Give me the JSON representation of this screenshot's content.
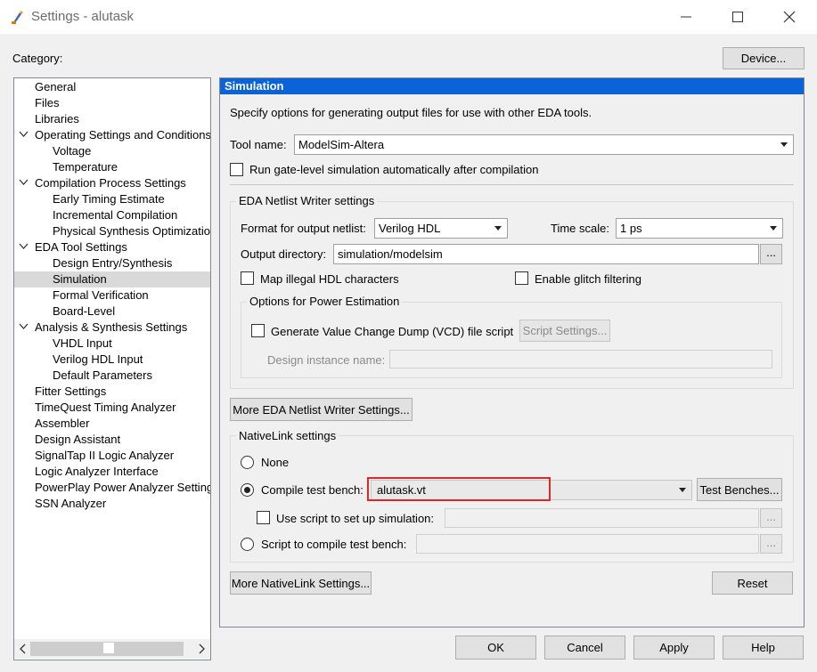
{
  "window": {
    "title": "Settings - alutask",
    "minimize_glyph": "—",
    "maximize_glyph": "☐",
    "close_glyph": "✕"
  },
  "category_label": "Category:",
  "device_button": "Device...",
  "tree": {
    "items": [
      {
        "label": "General",
        "level": 0,
        "expanded": null,
        "selected": false
      },
      {
        "label": "Files",
        "level": 0,
        "expanded": null,
        "selected": false
      },
      {
        "label": "Libraries",
        "level": 0,
        "expanded": null,
        "selected": false
      },
      {
        "label": "Operating Settings and Conditions",
        "level": 0,
        "expanded": true,
        "selected": false
      },
      {
        "label": "Voltage",
        "level": 1,
        "expanded": null,
        "selected": false
      },
      {
        "label": "Temperature",
        "level": 1,
        "expanded": null,
        "selected": false
      },
      {
        "label": "Compilation Process Settings",
        "level": 0,
        "expanded": true,
        "selected": false
      },
      {
        "label": "Early Timing Estimate",
        "level": 1,
        "expanded": null,
        "selected": false
      },
      {
        "label": "Incremental Compilation",
        "level": 1,
        "expanded": null,
        "selected": false
      },
      {
        "label": "Physical Synthesis Optimization",
        "level": 1,
        "expanded": null,
        "selected": false
      },
      {
        "label": "EDA Tool Settings",
        "level": 0,
        "expanded": true,
        "selected": false
      },
      {
        "label": "Design Entry/Synthesis",
        "level": 1,
        "expanded": null,
        "selected": false
      },
      {
        "label": "Simulation",
        "level": 1,
        "expanded": null,
        "selected": true
      },
      {
        "label": "Formal Verification",
        "level": 1,
        "expanded": null,
        "selected": false
      },
      {
        "label": "Board-Level",
        "level": 1,
        "expanded": null,
        "selected": false
      },
      {
        "label": "Analysis & Synthesis Settings",
        "level": 0,
        "expanded": true,
        "selected": false
      },
      {
        "label": "VHDL Input",
        "level": 1,
        "expanded": null,
        "selected": false
      },
      {
        "label": "Verilog HDL Input",
        "level": 1,
        "expanded": null,
        "selected": false
      },
      {
        "label": "Default Parameters",
        "level": 1,
        "expanded": null,
        "selected": false
      },
      {
        "label": "Fitter Settings",
        "level": 0,
        "expanded": null,
        "selected": false
      },
      {
        "label": "TimeQuest Timing Analyzer",
        "level": 0,
        "expanded": null,
        "selected": false
      },
      {
        "label": "Assembler",
        "level": 0,
        "expanded": null,
        "selected": false
      },
      {
        "label": "Design Assistant",
        "level": 0,
        "expanded": null,
        "selected": false
      },
      {
        "label": "SignalTap II Logic Analyzer",
        "level": 0,
        "expanded": null,
        "selected": false
      },
      {
        "label": "Logic Analyzer Interface",
        "level": 0,
        "expanded": null,
        "selected": false
      },
      {
        "label": "PowerPlay Power Analyzer Settings",
        "level": 0,
        "expanded": null,
        "selected": false
      },
      {
        "label": "SSN Analyzer",
        "level": 0,
        "expanded": null,
        "selected": false
      }
    ],
    "scroll_left_glyph": "‹",
    "scroll_right_glyph": "›"
  },
  "panel": {
    "header": "Simulation",
    "description": "Specify options for generating output files for use with other EDA tools.",
    "tool_name_label": "Tool name:",
    "tool_name_value": "ModelSim-Altera",
    "gate_level_label": "Run gate-level simulation automatically after compilation",
    "gate_level_checked": false,
    "netlist": {
      "group_title": "EDA Netlist Writer settings",
      "format_label": "Format for output netlist:",
      "format_value": "Verilog HDL",
      "timescale_label": "Time scale:",
      "timescale_value": "1 ps",
      "output_dir_label": "Output directory:",
      "output_dir_value": "simulation/modelsim",
      "browse_label": "...",
      "map_illegal_label": "Map illegal HDL characters",
      "map_illegal_checked": false,
      "glitch_label": "Enable glitch filtering",
      "glitch_checked": false,
      "power": {
        "group_title": "Options for Power Estimation",
        "vcd_label": "Generate Value Change Dump (VCD) file script",
        "vcd_checked": false,
        "script_settings_button": "Script Settings...",
        "design_instance_label": "Design instance name:",
        "design_instance_value": ""
      },
      "more_button": "More EDA Netlist Writer Settings..."
    },
    "nativelink": {
      "group_title": "NativeLink settings",
      "none_label": "None",
      "compile_tb_label": "Compile test bench:",
      "compile_tb_value": "alutask.vt",
      "test_benches_button": "Test Benches...",
      "use_script_label": "Use script to set up simulation:",
      "use_script_checked": false,
      "use_script_value": "",
      "script_compile_label": "Script to compile test bench:",
      "script_compile_value": "",
      "browse_label": "...",
      "selected_option": "compile_test_bench",
      "more_button": "More NativeLink Settings...",
      "reset_button": "Reset"
    },
    "highlight_color": "#e0262a"
  },
  "footer": {
    "ok": "OK",
    "cancel": "Cancel",
    "apply": "Apply",
    "help": "Help"
  },
  "colors": {
    "header_bg": "#0a64d8",
    "selected_bg": "#d9d9d9"
  }
}
